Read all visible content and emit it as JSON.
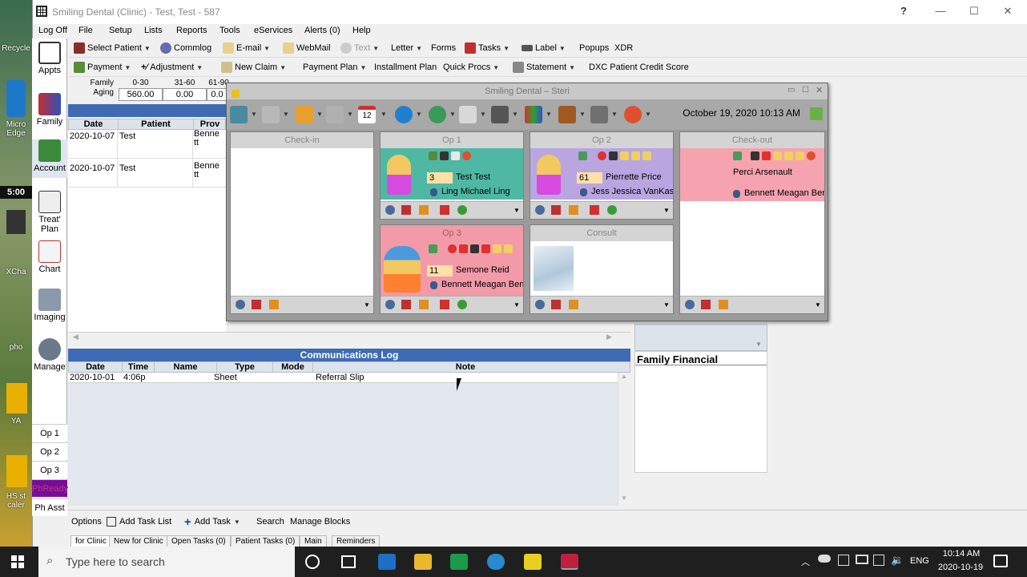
{
  "window": {
    "title": "Smiling Dental (Clinic) - Test, Test - 587",
    "help": "?"
  },
  "menu": [
    "Log Off",
    "File",
    "Setup",
    "Lists",
    "Reports",
    "Tools",
    "eServices",
    "Alerts (0)",
    "Help"
  ],
  "toolbar1": [
    "Select Patient",
    "Commlog",
    "E-mail",
    "WebMail",
    "Text",
    "Letter",
    "Forms",
    "Tasks",
    "Label",
    "Popups",
    "XDR"
  ],
  "toolbar2": [
    "Payment",
    "Adjustment",
    "New Claim",
    "Payment Plan",
    "Installment Plan",
    "Quick Procs",
    "Statement",
    "DXC Patient Credit Score"
  ],
  "modules": [
    "Appts",
    "Family",
    "Account",
    "Treat' Plan",
    "Chart",
    "Imaging",
    "Manage"
  ],
  "op_buttons": [
    "Op 1",
    "Op 2",
    "Op 3",
    "PhReady",
    "Ph Asst"
  ],
  "aging": {
    "label_family": "Family",
    "label_aging": "Aging",
    "headers": [
      "0-30",
      "31-60",
      "61-90"
    ],
    "values": [
      "560.00",
      "0.00",
      "0.0"
    ]
  },
  "account_grid": {
    "headers": [
      "Date",
      "Patient",
      "Prov"
    ],
    "rows": [
      {
        "date": "2020-10-07",
        "patient": "Test",
        "prov": "Benne tt"
      },
      {
        "date": "2020-10-07",
        "patient": "Test",
        "prov": "Benne tt"
      }
    ]
  },
  "commlog": {
    "title": "Communications Log",
    "headers": [
      "Date",
      "Time",
      "Name",
      "Type",
      "Mode",
      "Note"
    ],
    "rows": [
      {
        "date": "2020-10-01",
        "time": "4:06p",
        "name": "",
        "type": "Sheet",
        "mode": "",
        "note": "Referral Slip"
      }
    ]
  },
  "family_financial": "Family Financial",
  "steri": {
    "title": "Smiling Dental – Steri",
    "datetime": "October 19, 2020 10:13 AM",
    "calendar_day": "12",
    "rooms": {
      "checkin": {
        "name": "Check-in"
      },
      "op1": {
        "name": "Op 1",
        "num": "3",
        "patient": "Test Test",
        "staff": "Ling Michael Ling"
      },
      "op2": {
        "name": "Op 2",
        "num": "61",
        "patient": "Pierrette Price",
        "staff": "Jess Jessica VanKaster"
      },
      "checkout": {
        "name": "Check-out",
        "patient": "Perci Arsenault",
        "staff": "Bennett Meagan Benn"
      },
      "op3": {
        "name": "Op 3",
        "num": "11",
        "patient": "Semone Reid",
        "staff": "Bennett Meagan Benne"
      },
      "consult": {
        "name": "Consult"
      }
    },
    "colors": {
      "teal": "#4fb8a4",
      "purple": "#b9a6e0",
      "pink": "#f29aa8",
      "salmon": "#f5a3ae"
    }
  },
  "bottom": {
    "buttons": [
      "Options",
      "Add Task List",
      "Add Task",
      "Search",
      "Manage Blocks"
    ],
    "tabs": [
      "for Clinic",
      "New for Clinic",
      "Open Tasks (0)",
      "Patient Tasks (0)",
      "Main",
      "Reminders"
    ]
  },
  "desktop": {
    "icons": [
      "Recycle",
      "Micro Edge",
      "5:00",
      "XCha",
      "pho",
      "YA",
      "HS st caler"
    ]
  },
  "taskbar": {
    "search_placeholder": "Type here to search",
    "lang": "ENG",
    "time": "10:14 AM",
    "date": "2020-10-19"
  }
}
